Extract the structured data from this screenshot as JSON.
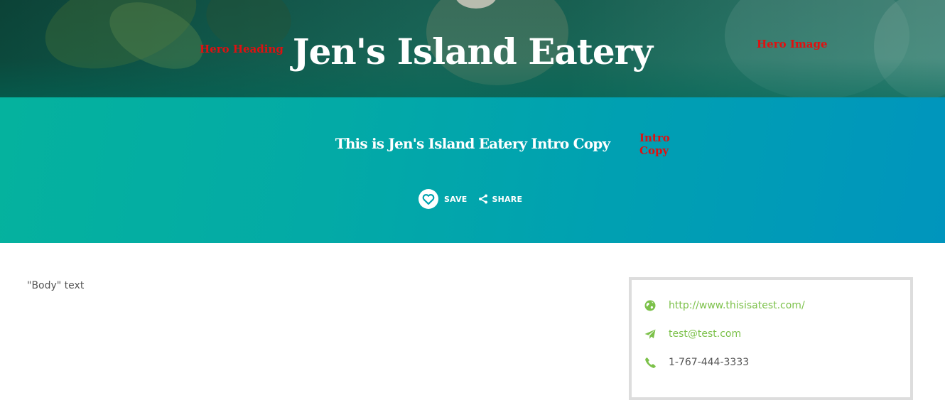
{
  "hero": {
    "heading": "Jen's Island Eatery",
    "annotation_heading": "Hero Heading",
    "annotation_image": "Hero Image"
  },
  "intro": {
    "copy": "This is Jen's Island Eatery Intro Copy",
    "annotation": "Intro Copy",
    "save_label": "SAVE",
    "share_label": "SHARE",
    "accent_color": "#00a3b0"
  },
  "body": {
    "text": "\"Body\" text"
  },
  "contact": {
    "website": "http://www.thisisatest.com/",
    "email": "test@test.com",
    "phone": "1-767-444-3333",
    "icons": [
      "globe-icon",
      "paper-plane-icon",
      "phone-icon"
    ],
    "link_color": "#7cc14a"
  }
}
